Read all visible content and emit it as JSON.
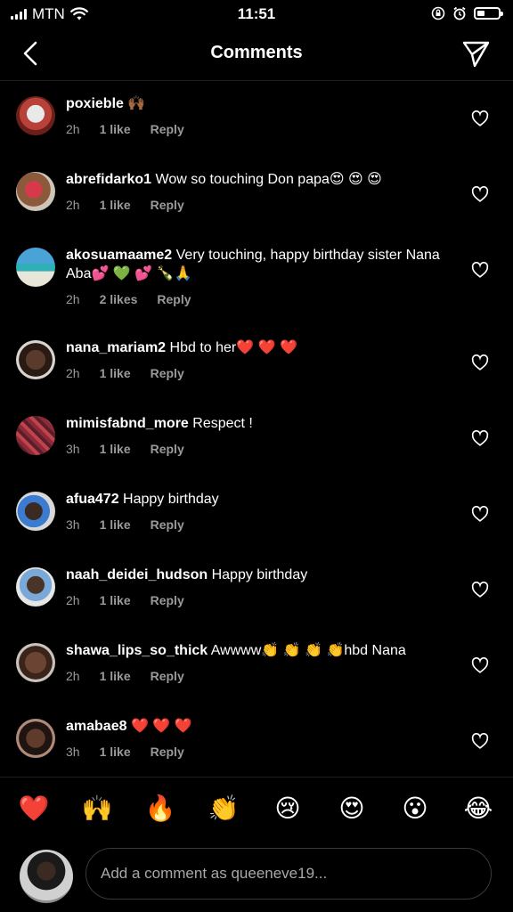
{
  "status_bar": {
    "carrier": "MTN",
    "time": "11:51"
  },
  "header": {
    "title": "Comments"
  },
  "comments": [
    {
      "username": "poxieble",
      "text": "🙌🏾",
      "time": "2h",
      "likes": "1 like",
      "reply": "Reply"
    },
    {
      "username": "abrefidarko1",
      "text": "Wow so touching Don papa😍 😍 😍",
      "time": "2h",
      "likes": "1 like",
      "reply": "Reply"
    },
    {
      "username": "akosuamaame2",
      "text": "Very touching, happy birthday sister Nana Aba💕 💚 💕 🍾🙏",
      "time": "2h",
      "likes": "2 likes",
      "reply": "Reply"
    },
    {
      "username": "nana_mariam2",
      "text": "Hbd to her❤️ ❤️ ❤️",
      "time": "2h",
      "likes": "1 like",
      "reply": "Reply"
    },
    {
      "username": "mimisfabnd_more",
      "text": "Respect !",
      "time": "3h",
      "likes": "1 like",
      "reply": "Reply"
    },
    {
      "username": "afua472",
      "text": "Happy birthday",
      "time": "3h",
      "likes": "1 like",
      "reply": "Reply"
    },
    {
      "username": "naah_deidei_hudson",
      "text": "Happy birthday",
      "time": "2h",
      "likes": "1 like",
      "reply": "Reply"
    },
    {
      "username": "shawa_lips_so_thick",
      "text": "Awwww👏 👏 👏 👏hbd Nana",
      "time": "2h",
      "likes": "1 like",
      "reply": "Reply"
    },
    {
      "username": "amabae8",
      "text": "❤️ ❤️ ❤️",
      "time": "3h",
      "likes": "1 like",
      "reply": "Reply"
    }
  ],
  "emoji_bar": [
    "❤️",
    "🙌",
    "🔥",
    "👏",
    "😢",
    "😍",
    "😮",
    "😂"
  ],
  "composer": {
    "placeholder": "Add a comment as queeneve19..."
  },
  "colors": {
    "background": "#000000",
    "text": "#ffffff",
    "muted": "#9a9a9a"
  },
  "icons": [
    "back-icon",
    "send-icon",
    "heart-outline-icon"
  ]
}
